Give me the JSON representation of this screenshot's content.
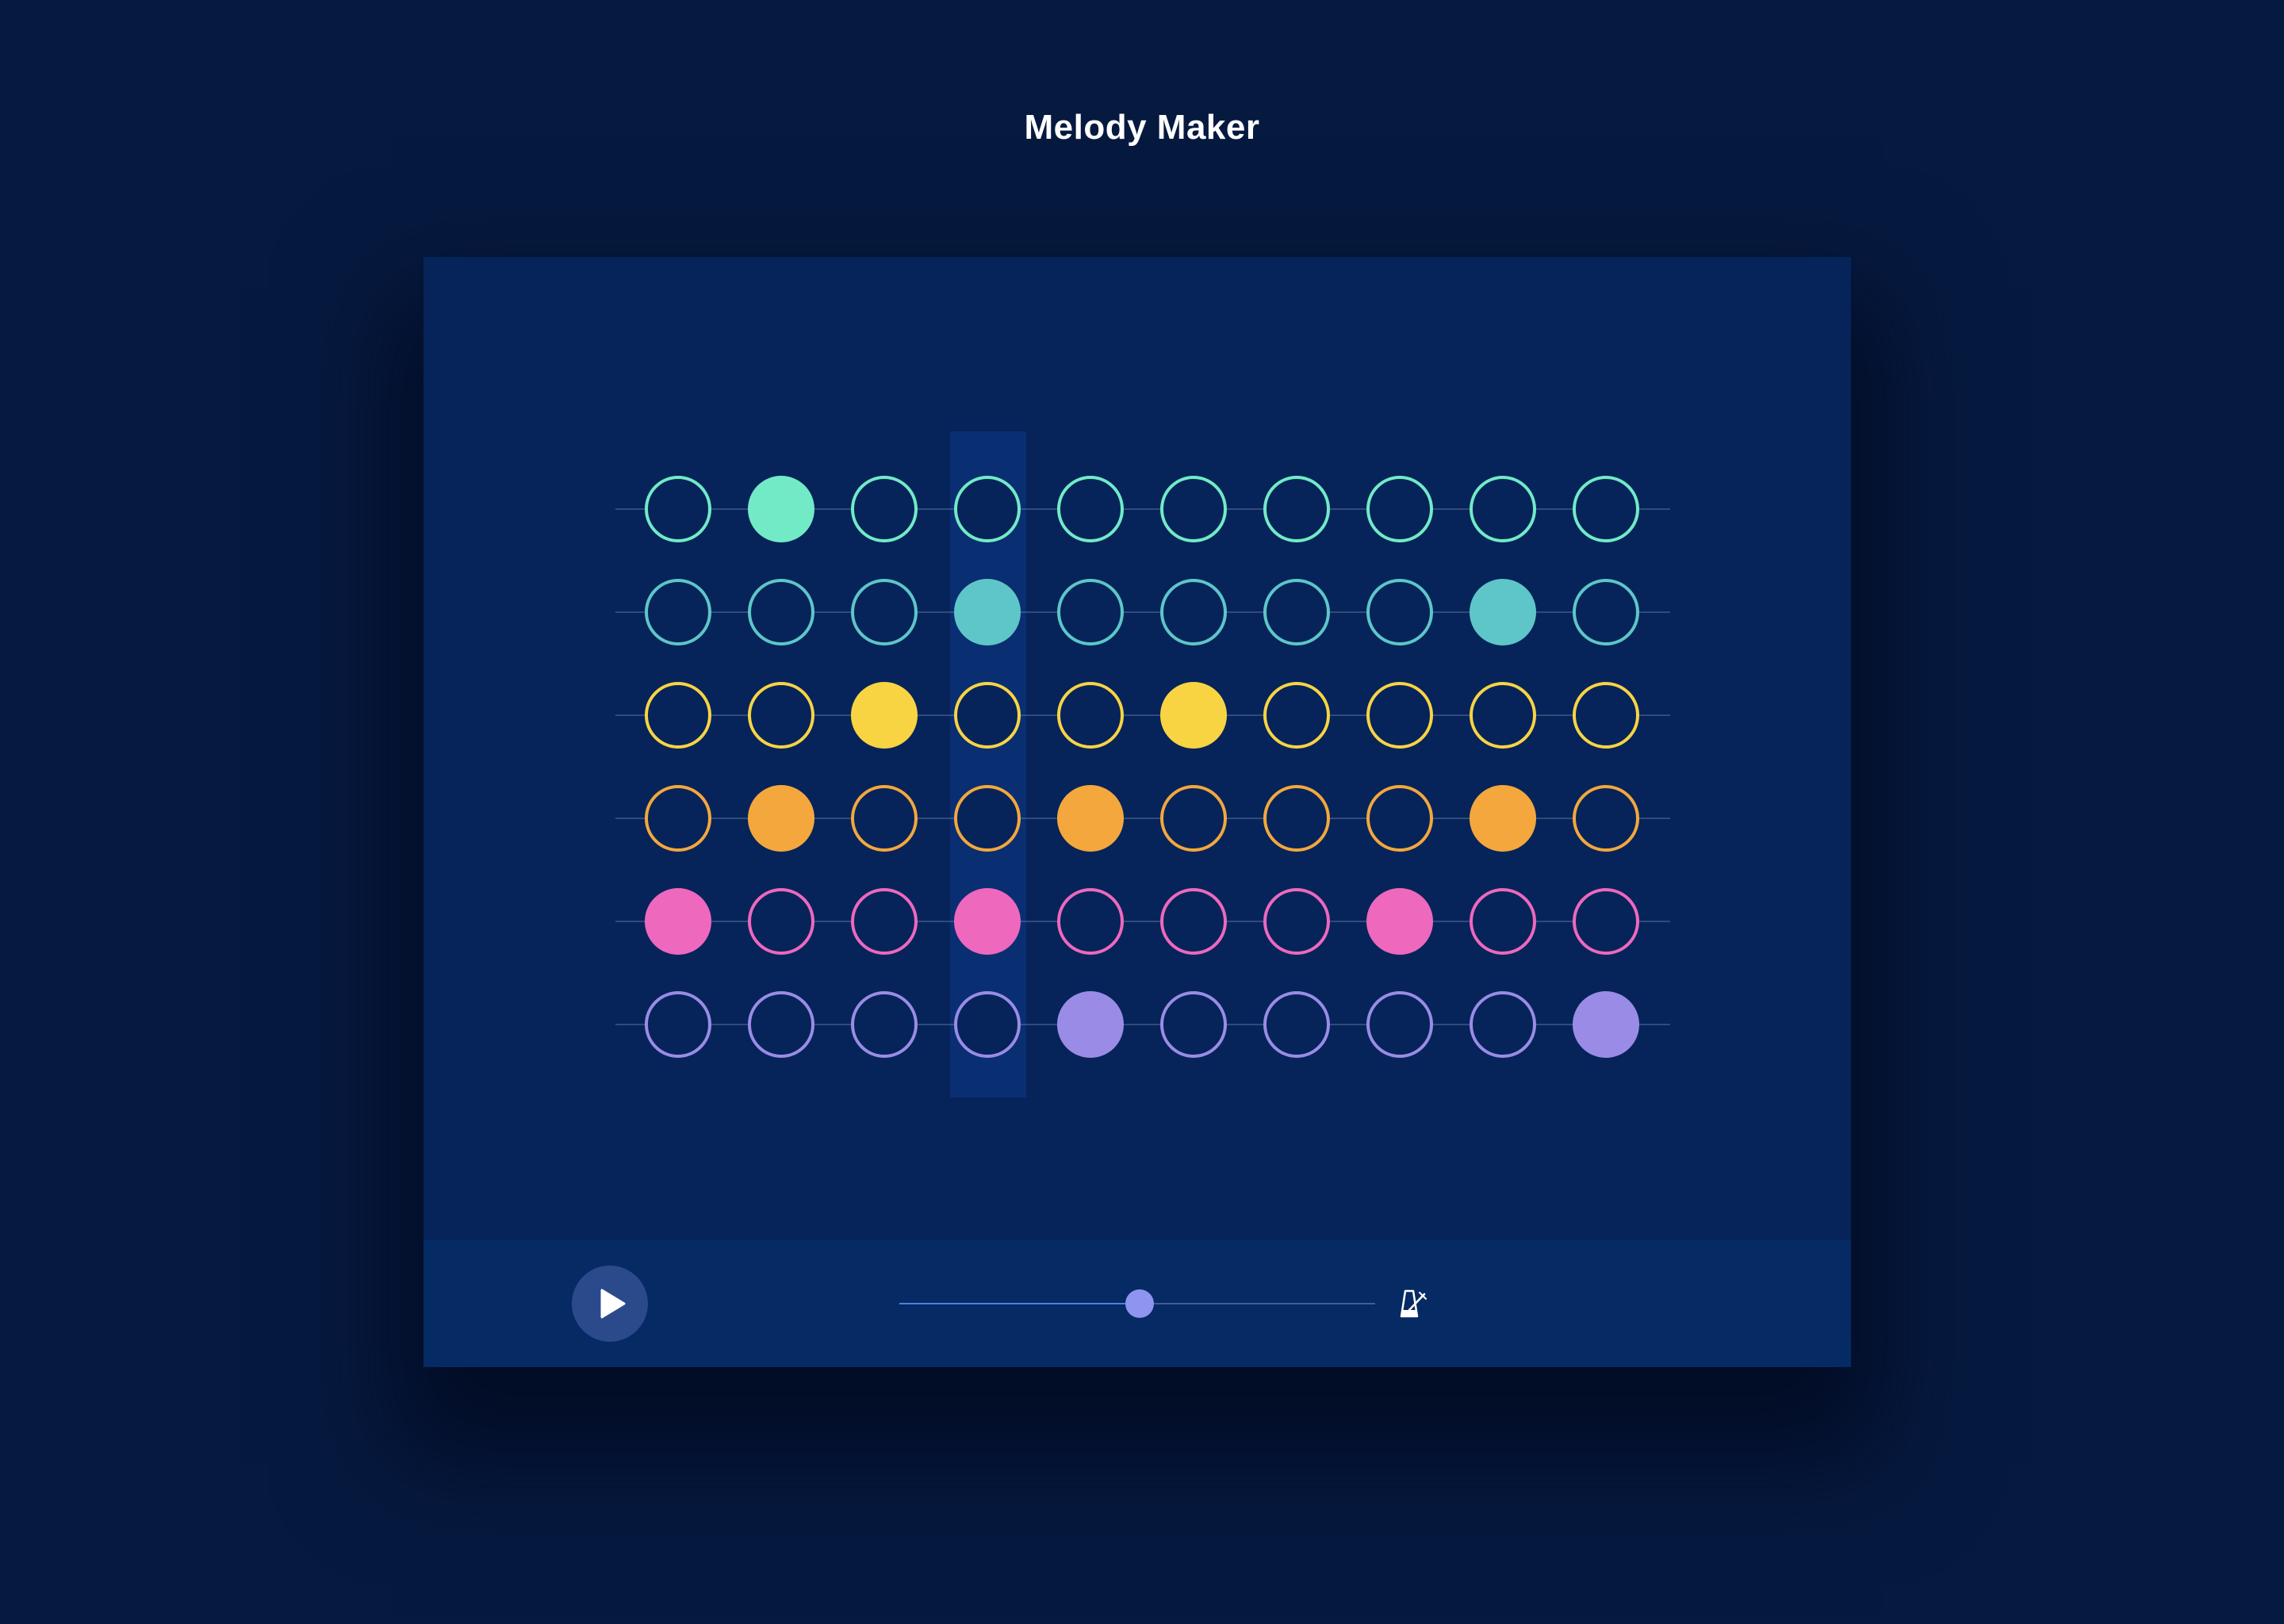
{
  "app": {
    "title": "Melody Maker"
  },
  "grid": {
    "columns": 10,
    "playhead_step": 3,
    "rows": [
      {
        "color": "#72eac6",
        "active": [
          1
        ]
      },
      {
        "color": "#5ec6c8",
        "active": [
          3,
          8
        ]
      },
      {
        "color": "#f8d443",
        "active": [
          2,
          5
        ]
      },
      {
        "color": "#f4a73c",
        "active": [
          1,
          4,
          8
        ]
      },
      {
        "color": "#ee68be",
        "active": [
          0,
          3,
          7
        ]
      },
      {
        "color": "#9a8ce6",
        "active": [
          4,
          9
        ]
      }
    ]
  },
  "controls": {
    "play_icon": "play-icon",
    "metronome_icon": "metronome-icon",
    "tempo_fraction": 0.505
  }
}
